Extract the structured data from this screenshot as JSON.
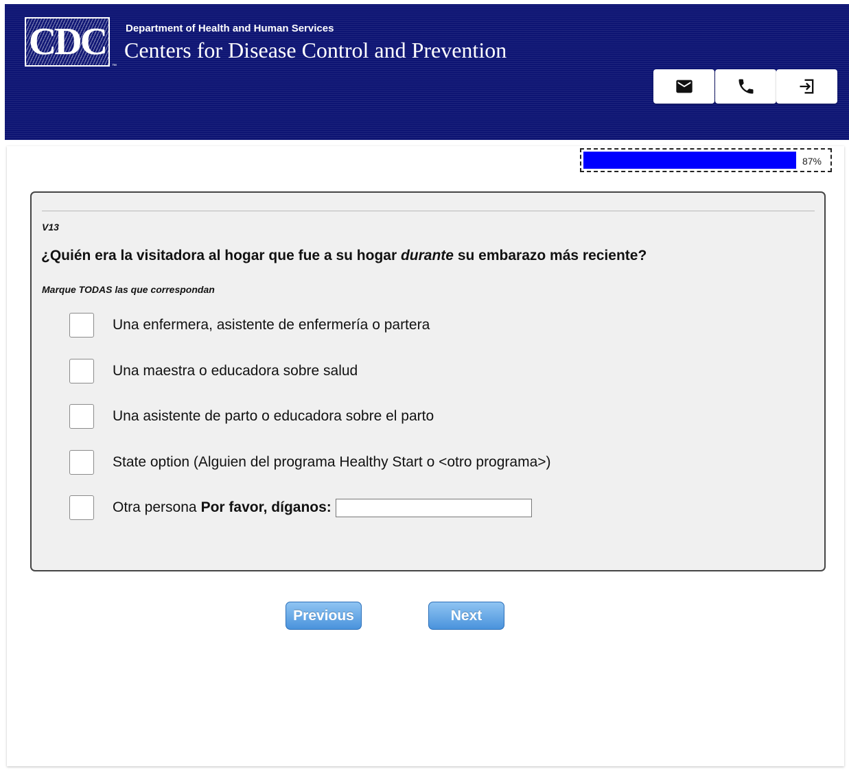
{
  "header": {
    "logo_text": "CDC",
    "logo_tm": "™",
    "department": "Department of Health and Human Services",
    "agency": "Centers for Disease Control and Prevention",
    "buttons": [
      {
        "icon": "mail-icon"
      },
      {
        "icon": "phone-icon"
      },
      {
        "icon": "exit-icon"
      }
    ]
  },
  "progress": {
    "percent": 87,
    "label": "87%",
    "fill_color": "#0000ff"
  },
  "question": {
    "code": "V13",
    "text_before": "¿Quién era la visitadora al hogar que fue a su hogar ",
    "text_emphasis": "durante",
    "text_after": " su embarazo más reciente?",
    "instruction": "Marque TODAS las que correspondan",
    "options": [
      {
        "label": "Una enfermera, asistente de enfermería o partera",
        "checked": false
      },
      {
        "label": "Una maestra o educadora sobre salud",
        "checked": false
      },
      {
        "label": "Una asistente de parto o educadora sobre el parto",
        "checked": false
      },
      {
        "label": "State option (Alguien del programa Healthy Start o <otro programa>)",
        "checked": false
      },
      {
        "label": "Otra persona",
        "prompt": "Por favor, díganos:",
        "input_value": "",
        "checked": false
      }
    ]
  },
  "nav": {
    "previous_label": "Previous",
    "next_label": "Next"
  },
  "colors": {
    "header_bg": "#0d1473",
    "button_blue": "#4a93dc"
  }
}
